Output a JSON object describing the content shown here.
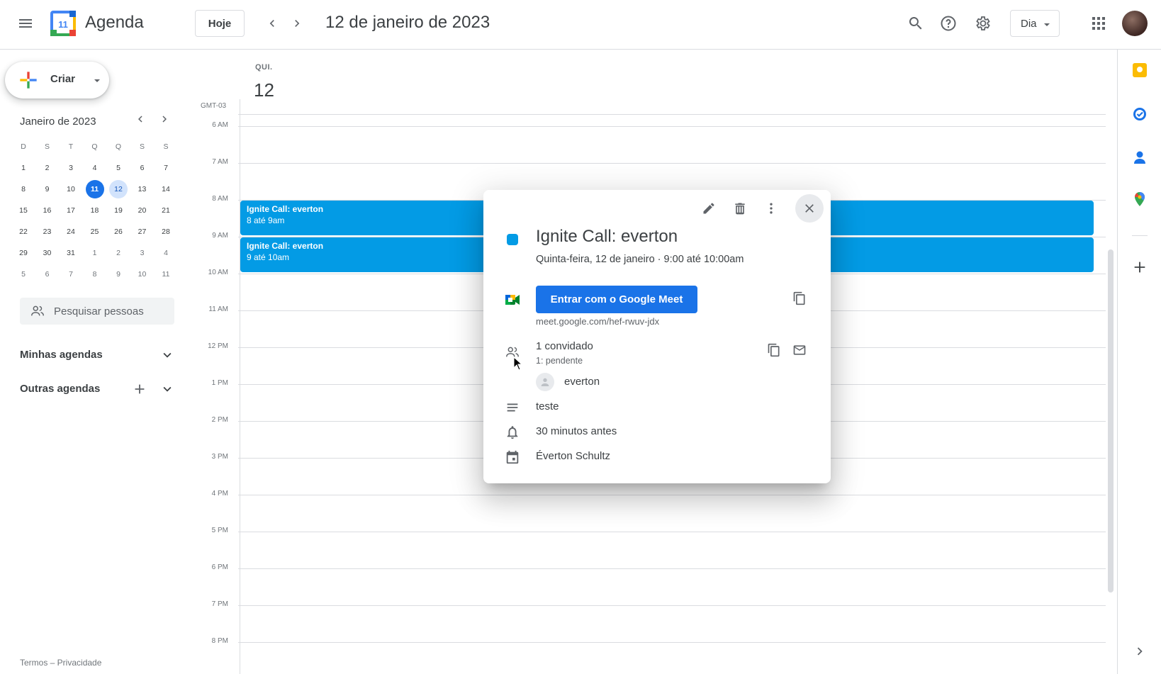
{
  "header": {
    "app_title": "Agenda",
    "logo_day": "11",
    "today_label": "Hoje",
    "date_title": "12 de janeiro de 2023",
    "view_label": "Dia"
  },
  "sidebar": {
    "create_label": "Criar",
    "mini_calendar": {
      "title": "Janeiro de 2023",
      "weekdays": [
        "D",
        "S",
        "T",
        "Q",
        "Q",
        "S",
        "S"
      ],
      "weeks": [
        [
          "1",
          "2",
          "3",
          "4",
          "5",
          "6",
          "7"
        ],
        [
          "8",
          "9",
          "10",
          "11",
          "12",
          "13",
          "14"
        ],
        [
          "15",
          "16",
          "17",
          "18",
          "19",
          "20",
          "21"
        ],
        [
          "22",
          "23",
          "24",
          "25",
          "26",
          "27",
          "28"
        ],
        [
          "29",
          "30",
          "31",
          "1",
          "2",
          "3",
          "4"
        ],
        [
          "5",
          "6",
          "7",
          "8",
          "9",
          "10",
          "11"
        ]
      ],
      "today": "11",
      "selected": "12"
    },
    "search_people_placeholder": "Pesquisar pessoas",
    "my_calendars": "Minhas agendas",
    "other_calendars": "Outras agendas",
    "footer": "Termos – Privacidade"
  },
  "day_view": {
    "day_name": "QUI.",
    "day_number": "12",
    "timezone": "GMT-03",
    "hours": [
      "6 AM",
      "7 AM",
      "8 AM",
      "9 AM",
      "10 AM",
      "11 AM",
      "12 PM",
      "1 PM",
      "2 PM",
      "3 PM",
      "4 PM",
      "5 PM",
      "6 PM",
      "7 PM",
      "8 PM"
    ],
    "events": [
      {
        "title": "Ignite Call: everton",
        "time": "8 até 9am"
      },
      {
        "title": "Ignite Call: everton",
        "time": "9 até 10am"
      }
    ],
    "event_color": "#039be5"
  },
  "popup": {
    "title": "Ignite Call: everton",
    "subtitle": "Quinta-feira, 12 de janeiro  ·  9:00 até 10:00am",
    "meet_button": "Entrar com o Google Meet",
    "meet_link": "meet.google.com/hef-rwuv-jdx",
    "guests_count": "1 convidado",
    "guests_status": "1: pendente",
    "guest_name": "everton",
    "description": "teste",
    "reminder": "30 minutos antes",
    "organizer": "Éverton Schultz",
    "color": "#039be5"
  },
  "colors": {
    "accent": "#1a73e8",
    "event": "#039be5"
  }
}
